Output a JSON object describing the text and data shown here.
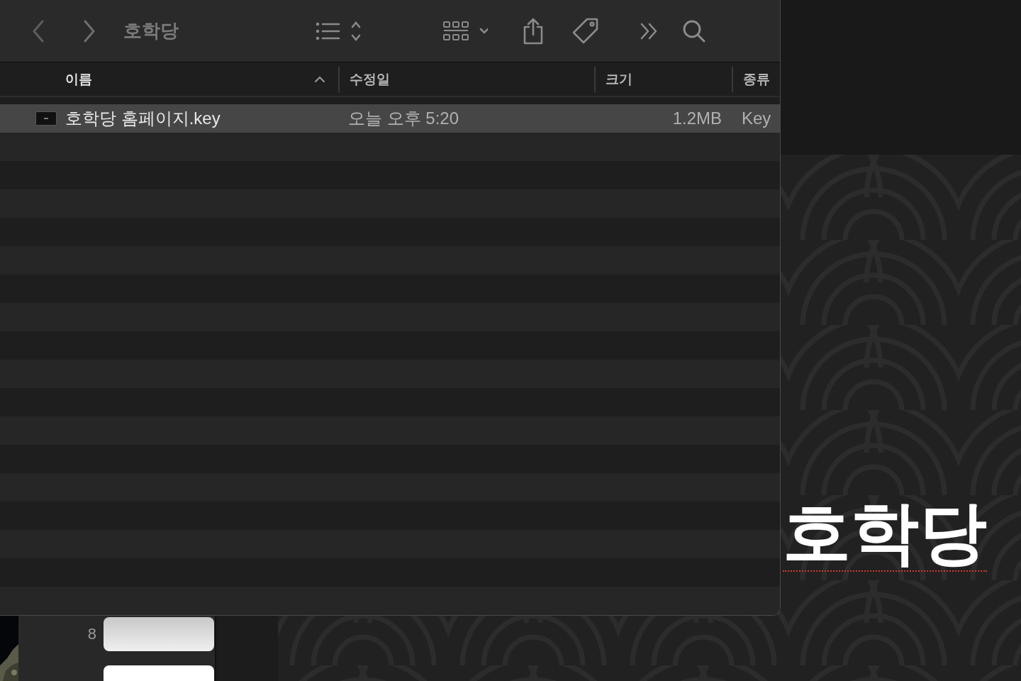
{
  "window": {
    "title": "호학당"
  },
  "columns": [
    {
      "label": "이름",
      "sorted": true
    },
    {
      "label": "수정일",
      "sorted": false
    },
    {
      "label": "크기",
      "sorted": false
    },
    {
      "label": "종류",
      "sorted": false
    }
  ],
  "files": [
    {
      "name": "호학당 홈페이지.key",
      "modified": "오늘 오후 5:20",
      "size": "1.2MB",
      "kind": "Key",
      "selected": true
    }
  ],
  "slide_navigator": {
    "slide_number": "8"
  },
  "slide": {
    "title": "호학당",
    "misspelled": true
  }
}
